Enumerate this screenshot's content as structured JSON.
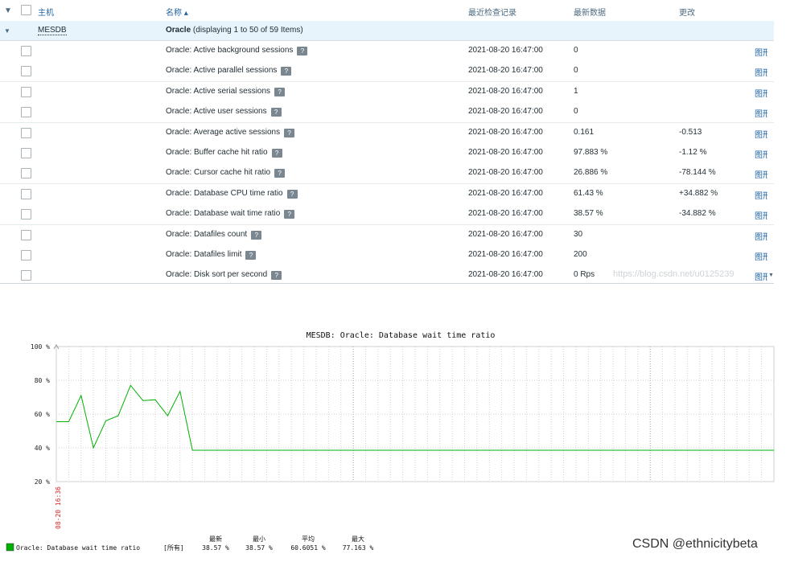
{
  "header": {
    "host_col": "主机",
    "name_col": "名称 ▴",
    "time_col": "最近检查记录",
    "value_col": "最新数据",
    "change_col": "更改"
  },
  "group": {
    "host": "MESDB",
    "title": "Oracle (displaying 1 to 50 of 59 Items)"
  },
  "rows": [
    {
      "name": "Oracle: Active background sessions",
      "time": "2021-08-20 16:47:00",
      "value": "0",
      "change": "",
      "graph": "图形"
    },
    {
      "name": "Oracle: Active parallel sessions",
      "time": "2021-08-20 16:47:00",
      "value": "0",
      "change": "",
      "graph": "图形"
    },
    {
      "name": "Oracle: Active serial sessions",
      "time": "2021-08-20 16:47:00",
      "value": "1",
      "change": "",
      "graph": "图形"
    },
    {
      "name": "Oracle: Active user sessions",
      "time": "2021-08-20 16:47:00",
      "value": "0",
      "change": "",
      "graph": "图形"
    },
    {
      "name": "Oracle: Average active sessions",
      "time": "2021-08-20 16:47:00",
      "value": "0.161",
      "change": "-0.513",
      "graph": "图形"
    },
    {
      "name": "Oracle: Buffer cache hit ratio",
      "time": "2021-08-20 16:47:00",
      "value": "97.883 %",
      "change": "-1.12 %",
      "graph": "图形"
    },
    {
      "name": "Oracle: Cursor cache hit ratio",
      "time": "2021-08-20 16:47:00",
      "value": "26.886 %",
      "change": "-78.144 %",
      "graph": "图形"
    },
    {
      "name": "Oracle: Database CPU time ratio",
      "time": "2021-08-20 16:47:00",
      "value": "61.43 %",
      "change": "+34.882 %",
      "graph": "图形"
    },
    {
      "name": "Oracle: Database wait time ratio",
      "time": "2021-08-20 16:47:00",
      "value": "38.57 %",
      "change": "-34.882 %",
      "graph": "图形"
    },
    {
      "name": "Oracle: Datafiles count",
      "time": "2021-08-20 16:47:00",
      "value": "30",
      "change": "",
      "graph": "图形"
    },
    {
      "name": "Oracle: Datafiles limit",
      "time": "2021-08-20 16:47:00",
      "value": "200",
      "change": "",
      "graph": "图形"
    },
    {
      "name": "Oracle: Disk sort per second",
      "time": "2021-08-20 16:47:00",
      "value": "0 Rps",
      "change": "",
      "graph": "图形"
    }
  ],
  "help_icon": "question-icon",
  "watermark_url": "https://blog.csdn.net/u0125239",
  "watermark_csdn": "CSDN @ethnicitybeta",
  "chart_data": {
    "type": "line",
    "title": "MESDB: Oracle: Database wait time ratio",
    "y_ticks": [
      "100 %",
      "80 %",
      "60 %",
      "40 %",
      "20 %"
    ],
    "ylim": [
      20,
      100
    ],
    "x_start_label": "08-20 16:36",
    "series": [
      {
        "name": "Oracle: Database wait time ratio",
        "color": "#00b000",
        "values": [
          55.5,
          55.5,
          71,
          40,
          56,
          59,
          77,
          68,
          68.5,
          59,
          73.5,
          38.57,
          38.57,
          38.57,
          38.57,
          38.57,
          38.57,
          38.57,
          38.57,
          38.57,
          38.57,
          38.57,
          38.57,
          38.57,
          38.57,
          38.57,
          38.57,
          38.57,
          38.57,
          38.57,
          38.57,
          38.57,
          38.57,
          38.57,
          38.57,
          38.57,
          38.57,
          38.57,
          38.57,
          38.57,
          38.57,
          38.57,
          38.57,
          38.57,
          38.57,
          38.57,
          38.57,
          38.57,
          38.57,
          38.57,
          38.57,
          38.57,
          38.57,
          38.57,
          38.57,
          38.57,
          38.57,
          38.57,
          38.57
        ]
      }
    ],
    "legend": {
      "series_name": "Oracle: Database wait time ratio",
      "func": "[所有]",
      "col_last": "最新",
      "col_min": "最小",
      "col_avg": "平均",
      "col_max": "最大",
      "last": "38.57 %",
      "min": "38.57 %",
      "avg": "60.6051 %",
      "max": "77.163 %"
    }
  }
}
